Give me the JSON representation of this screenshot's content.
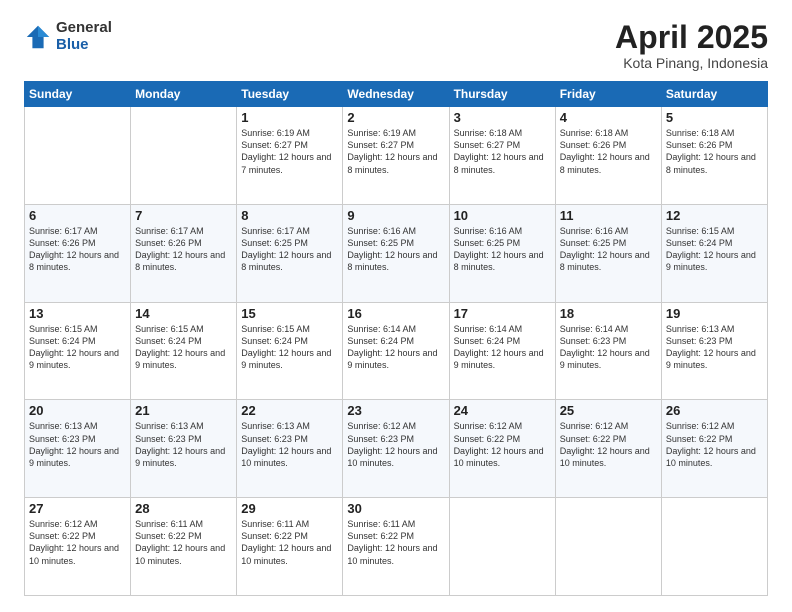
{
  "header": {
    "logo_general": "General",
    "logo_blue": "Blue",
    "title": "April 2025",
    "location": "Kota Pinang, Indonesia"
  },
  "weekdays": [
    "Sunday",
    "Monday",
    "Tuesday",
    "Wednesday",
    "Thursday",
    "Friday",
    "Saturday"
  ],
  "weeks": [
    [
      {
        "day": "",
        "detail": ""
      },
      {
        "day": "",
        "detail": ""
      },
      {
        "day": "1",
        "detail": "Sunrise: 6:19 AM\nSunset: 6:27 PM\nDaylight: 12 hours and 7 minutes."
      },
      {
        "day": "2",
        "detail": "Sunrise: 6:19 AM\nSunset: 6:27 PM\nDaylight: 12 hours and 8 minutes."
      },
      {
        "day": "3",
        "detail": "Sunrise: 6:18 AM\nSunset: 6:27 PM\nDaylight: 12 hours and 8 minutes."
      },
      {
        "day": "4",
        "detail": "Sunrise: 6:18 AM\nSunset: 6:26 PM\nDaylight: 12 hours and 8 minutes."
      },
      {
        "day": "5",
        "detail": "Sunrise: 6:18 AM\nSunset: 6:26 PM\nDaylight: 12 hours and 8 minutes."
      }
    ],
    [
      {
        "day": "6",
        "detail": "Sunrise: 6:17 AM\nSunset: 6:26 PM\nDaylight: 12 hours and 8 minutes."
      },
      {
        "day": "7",
        "detail": "Sunrise: 6:17 AM\nSunset: 6:26 PM\nDaylight: 12 hours and 8 minutes."
      },
      {
        "day": "8",
        "detail": "Sunrise: 6:17 AM\nSunset: 6:25 PM\nDaylight: 12 hours and 8 minutes."
      },
      {
        "day": "9",
        "detail": "Sunrise: 6:16 AM\nSunset: 6:25 PM\nDaylight: 12 hours and 8 minutes."
      },
      {
        "day": "10",
        "detail": "Sunrise: 6:16 AM\nSunset: 6:25 PM\nDaylight: 12 hours and 8 minutes."
      },
      {
        "day": "11",
        "detail": "Sunrise: 6:16 AM\nSunset: 6:25 PM\nDaylight: 12 hours and 8 minutes."
      },
      {
        "day": "12",
        "detail": "Sunrise: 6:15 AM\nSunset: 6:24 PM\nDaylight: 12 hours and 9 minutes."
      }
    ],
    [
      {
        "day": "13",
        "detail": "Sunrise: 6:15 AM\nSunset: 6:24 PM\nDaylight: 12 hours and 9 minutes."
      },
      {
        "day": "14",
        "detail": "Sunrise: 6:15 AM\nSunset: 6:24 PM\nDaylight: 12 hours and 9 minutes."
      },
      {
        "day": "15",
        "detail": "Sunrise: 6:15 AM\nSunset: 6:24 PM\nDaylight: 12 hours and 9 minutes."
      },
      {
        "day": "16",
        "detail": "Sunrise: 6:14 AM\nSunset: 6:24 PM\nDaylight: 12 hours and 9 minutes."
      },
      {
        "day": "17",
        "detail": "Sunrise: 6:14 AM\nSunset: 6:24 PM\nDaylight: 12 hours and 9 minutes."
      },
      {
        "day": "18",
        "detail": "Sunrise: 6:14 AM\nSunset: 6:23 PM\nDaylight: 12 hours and 9 minutes."
      },
      {
        "day": "19",
        "detail": "Sunrise: 6:13 AM\nSunset: 6:23 PM\nDaylight: 12 hours and 9 minutes."
      }
    ],
    [
      {
        "day": "20",
        "detail": "Sunrise: 6:13 AM\nSunset: 6:23 PM\nDaylight: 12 hours and 9 minutes."
      },
      {
        "day": "21",
        "detail": "Sunrise: 6:13 AM\nSunset: 6:23 PM\nDaylight: 12 hours and 9 minutes."
      },
      {
        "day": "22",
        "detail": "Sunrise: 6:13 AM\nSunset: 6:23 PM\nDaylight: 12 hours and 10 minutes."
      },
      {
        "day": "23",
        "detail": "Sunrise: 6:12 AM\nSunset: 6:23 PM\nDaylight: 12 hours and 10 minutes."
      },
      {
        "day": "24",
        "detail": "Sunrise: 6:12 AM\nSunset: 6:22 PM\nDaylight: 12 hours and 10 minutes."
      },
      {
        "day": "25",
        "detail": "Sunrise: 6:12 AM\nSunset: 6:22 PM\nDaylight: 12 hours and 10 minutes."
      },
      {
        "day": "26",
        "detail": "Sunrise: 6:12 AM\nSunset: 6:22 PM\nDaylight: 12 hours and 10 minutes."
      }
    ],
    [
      {
        "day": "27",
        "detail": "Sunrise: 6:12 AM\nSunset: 6:22 PM\nDaylight: 12 hours and 10 minutes."
      },
      {
        "day": "28",
        "detail": "Sunrise: 6:11 AM\nSunset: 6:22 PM\nDaylight: 12 hours and 10 minutes."
      },
      {
        "day": "29",
        "detail": "Sunrise: 6:11 AM\nSunset: 6:22 PM\nDaylight: 12 hours and 10 minutes."
      },
      {
        "day": "30",
        "detail": "Sunrise: 6:11 AM\nSunset: 6:22 PM\nDaylight: 12 hours and 10 minutes."
      },
      {
        "day": "",
        "detail": ""
      },
      {
        "day": "",
        "detail": ""
      },
      {
        "day": "",
        "detail": ""
      }
    ]
  ]
}
